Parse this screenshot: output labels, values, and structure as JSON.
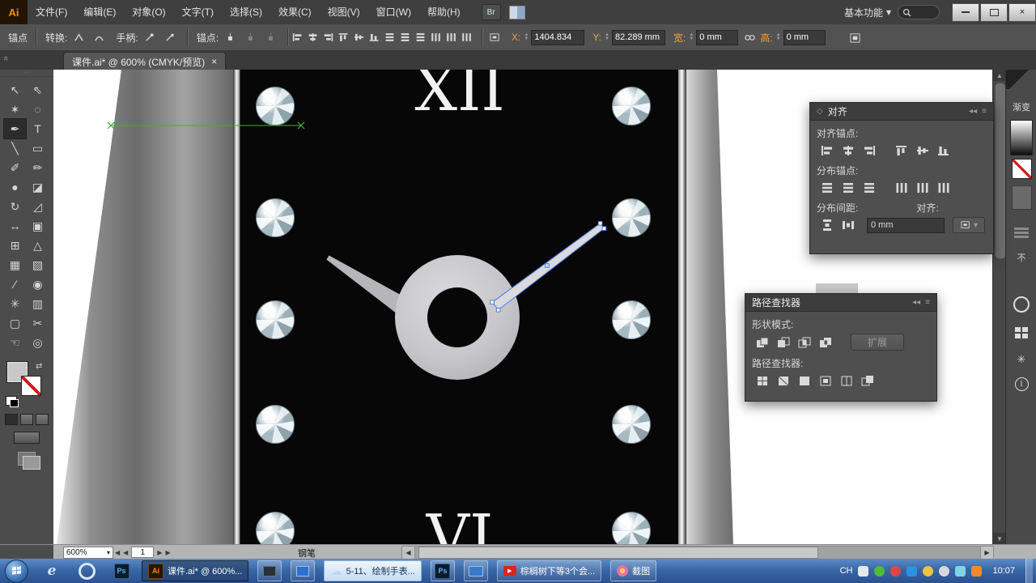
{
  "menu_bar": {
    "logo": "Ai",
    "items": [
      "文件(F)",
      "编辑(E)",
      "对象(O)",
      "文字(T)",
      "选择(S)",
      "效果(C)",
      "视图(V)",
      "窗口(W)",
      "帮助(H)"
    ],
    "bridge": "Br",
    "workspace": "基本功能"
  },
  "icons": {
    "caret": "▾",
    "close": "×",
    "left": "◀",
    "right": "▶",
    "up": "▲",
    "down": "▼",
    "swap": "⇄",
    "dots": "∙∙∙∙",
    "chevrons": "«",
    "collapse": "◂◂",
    "menu": "≡",
    "diamond": "◇",
    "info": "i"
  },
  "control_bar": {
    "context": "锚点",
    "convert": "转换:",
    "handles": "手柄:",
    "anchors": "锚点:",
    "x_label": "X:",
    "x_value": "1404.834",
    "y_label": "Y:",
    "y_value": "82.289 mm",
    "w_label": "宽:",
    "w_value": "0 mm",
    "h_label": "高:",
    "h_value": "0 mm"
  },
  "tab_bar": {
    "title": "课件.ai* @ 600% (CMYK/预览)"
  },
  "toolbar": {
    "tools": [
      {
        "id": "selection",
        "glyph": "↖"
      },
      {
        "id": "direct-selection",
        "glyph": "⇖"
      },
      {
        "id": "magic-wand",
        "glyph": "✶"
      },
      {
        "id": "lasso",
        "glyph": "◌"
      },
      {
        "id": "pen",
        "glyph": "✒"
      },
      {
        "id": "type",
        "glyph": "T"
      },
      {
        "id": "line",
        "glyph": "╲"
      },
      {
        "id": "rectangle",
        "glyph": "▭"
      },
      {
        "id": "paintbrush",
        "glyph": "✐"
      },
      {
        "id": "pencil",
        "glyph": "✏"
      },
      {
        "id": "blob-brush",
        "glyph": "●"
      },
      {
        "id": "eraser",
        "glyph": "◪"
      },
      {
        "id": "rotate",
        "glyph": "↻"
      },
      {
        "id": "scale",
        "glyph": "◿"
      },
      {
        "id": "width",
        "glyph": "↔"
      },
      {
        "id": "free-transform",
        "glyph": "▣"
      },
      {
        "id": "shape-builder",
        "glyph": "⊞"
      },
      {
        "id": "perspective-grid",
        "glyph": "△"
      },
      {
        "id": "mesh",
        "glyph": "▦"
      },
      {
        "id": "gradient",
        "glyph": "▨"
      },
      {
        "id": "eyedropper",
        "glyph": "∕"
      },
      {
        "id": "blend",
        "glyph": "◉"
      },
      {
        "id": "symbol-sprayer",
        "glyph": "✳"
      },
      {
        "id": "column-graph",
        "glyph": "▥"
      },
      {
        "id": "artboard",
        "glyph": "▢"
      },
      {
        "id": "slice",
        "glyph": "✂"
      },
      {
        "id": "hand",
        "glyph": "☜"
      },
      {
        "id": "zoom",
        "glyph": "◎"
      }
    ]
  },
  "canvas": {
    "numeral_top": "XII",
    "numeral_bottom": "VI"
  },
  "align_panel": {
    "title": "对齐",
    "align_anchors_label": "对齐锚点:",
    "distribute_anchors_label": "分布锚点:",
    "spacing_label": "分布间距:",
    "spacing_value": "0 mm",
    "align_to_label": "对齐:"
  },
  "pathfinder_panel": {
    "title": "路径查找器",
    "shape_modes_label": "形状模式:",
    "expand_button": "扩展",
    "pathfinder_label": "路径查找器:"
  },
  "dock": {
    "gradient_label": "渐变",
    "partial_label": "不"
  },
  "status_bar": {
    "zoom": "600%",
    "artboard": "1",
    "tool_name": "钢笔"
  },
  "taskbar": {
    "active_window": "课件.ai* @ 600%...",
    "window2": "5-11、绘制手表...",
    "window3": "棕榈树下等3个会...",
    "window4": "截图",
    "ime": "CH",
    "time": "10:07",
    "ie_glyph": "e",
    "ps_glyph": "Ps",
    "ai_glyph": "Ai",
    "cloud_glyph": "☁",
    "play_glyph": "▶"
  },
  "colors": {
    "selection_blue": "#4d7ce2",
    "guide_green": "#3bb039",
    "amber_label": "#e8a33d"
  }
}
